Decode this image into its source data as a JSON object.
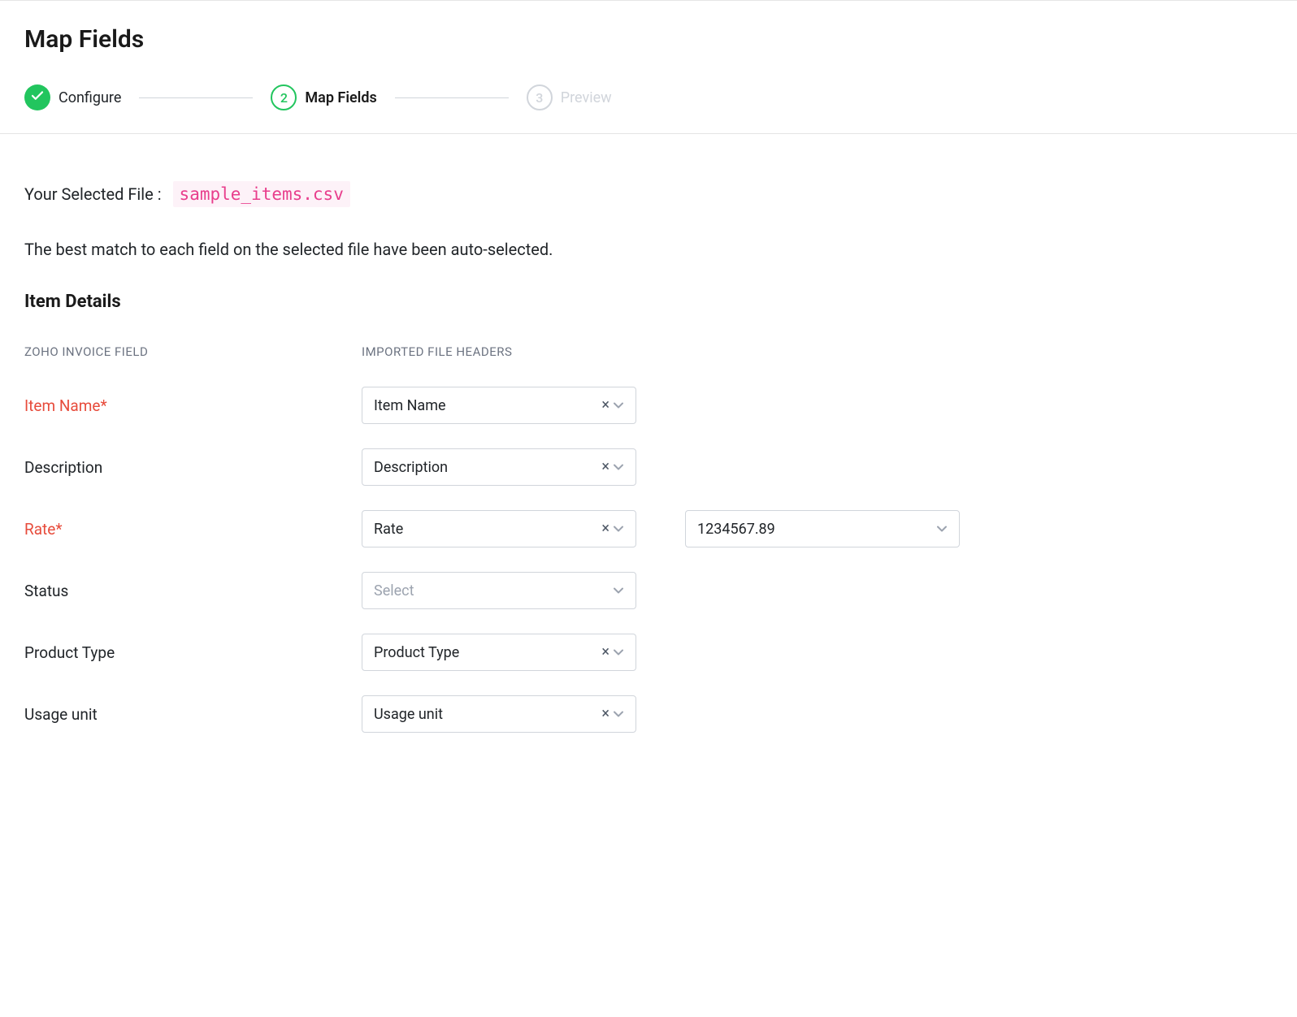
{
  "header": {
    "title": "Map Fields"
  },
  "stepper": {
    "steps": [
      {
        "number": "",
        "label": "Configure",
        "state": "complete"
      },
      {
        "number": "2",
        "label": "Map Fields",
        "state": "active"
      },
      {
        "number": "3",
        "label": "Preview",
        "state": "pending"
      }
    ]
  },
  "content": {
    "file_label": "Your Selected File :",
    "file_name": "sample_items.csv",
    "description": "The best match to each field on the selected file have been auto-selected.",
    "section_title": "Item Details",
    "col_headers": {
      "left": "ZOHO INVOICE FIELD",
      "right": "IMPORTED FILE HEADERS"
    },
    "rows": [
      {
        "label": "Item Name*",
        "required": true,
        "value": "Item Name",
        "has_value": true,
        "extra": null
      },
      {
        "label": "Description",
        "required": false,
        "value": "Description",
        "has_value": true,
        "extra": null
      },
      {
        "label": "Rate*",
        "required": true,
        "value": "Rate",
        "has_value": true,
        "extra": "1234567.89"
      },
      {
        "label": "Status",
        "required": false,
        "value": "Select",
        "has_value": false,
        "extra": null
      },
      {
        "label": "Product Type",
        "required": false,
        "value": "Product Type",
        "has_value": true,
        "extra": null
      },
      {
        "label": "Usage unit",
        "required": false,
        "value": "Usage unit",
        "has_value": true,
        "extra": null
      }
    ]
  }
}
